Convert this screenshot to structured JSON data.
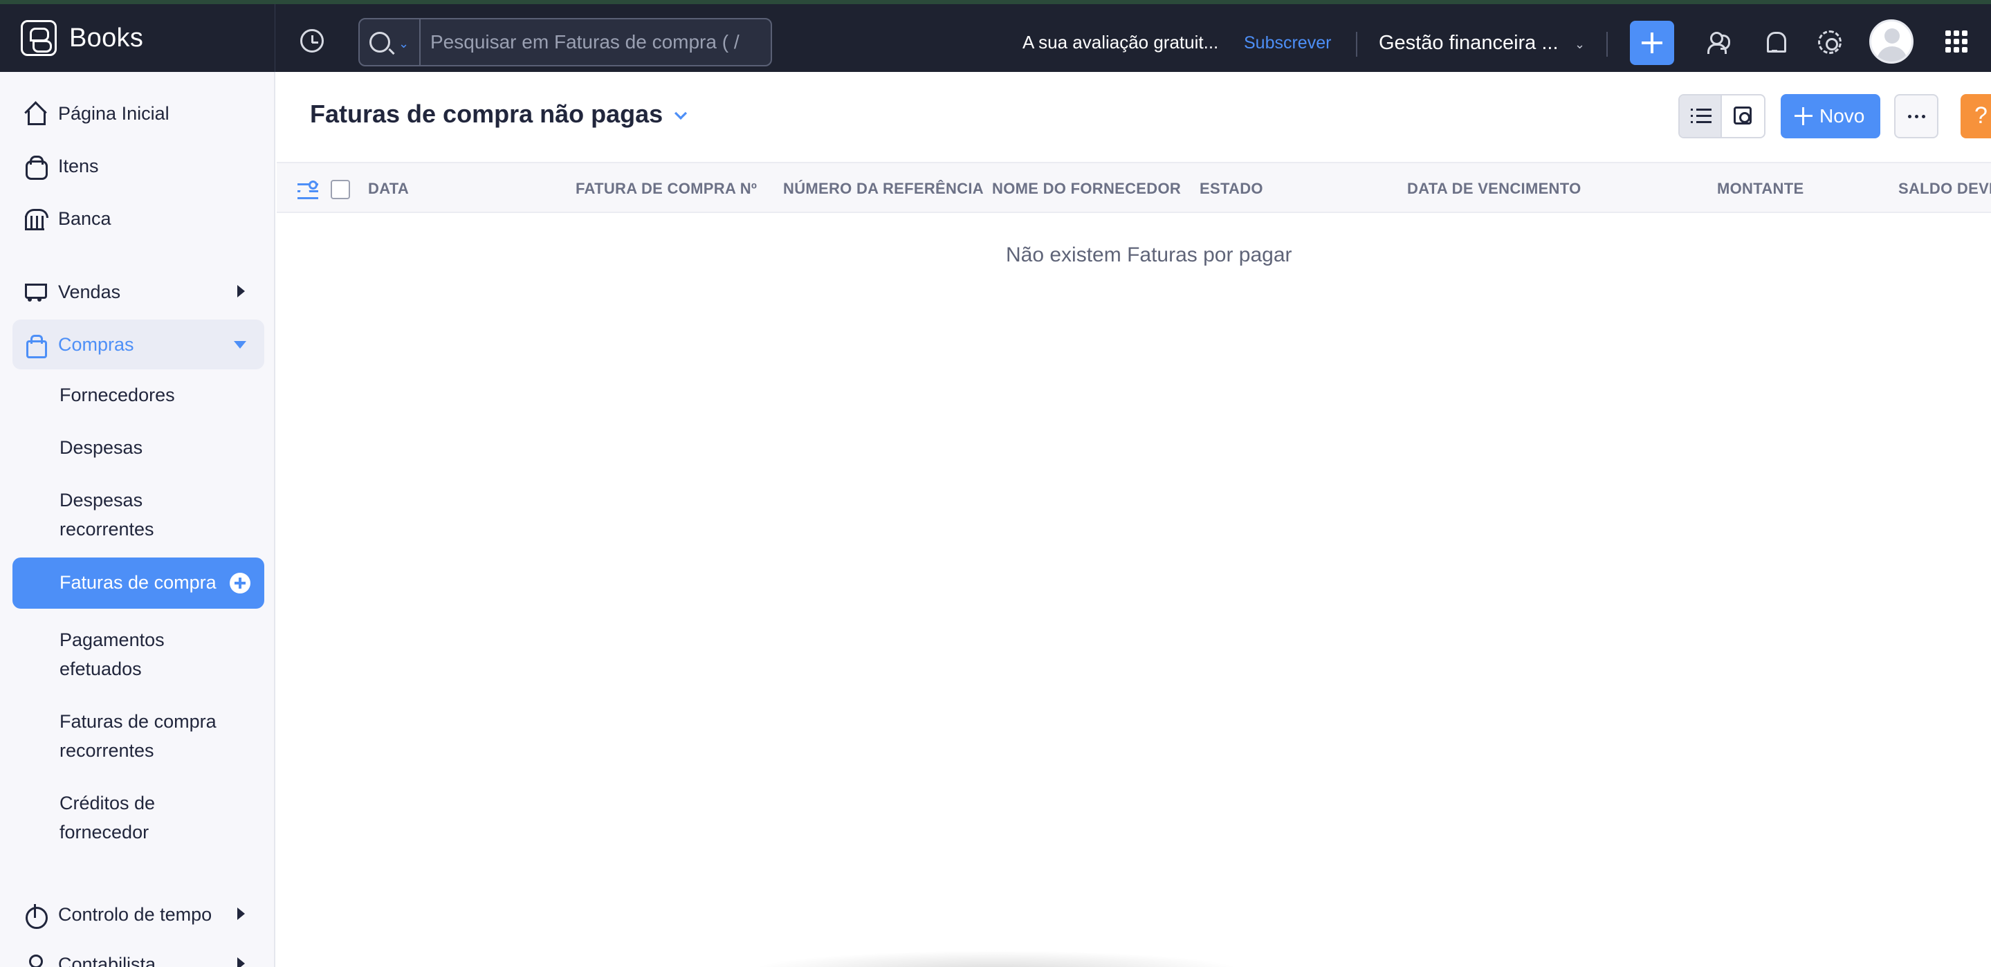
{
  "app": {
    "name": "Books"
  },
  "topbar": {
    "search_placeholder": "Pesquisar em Faturas de compra ( / ",
    "trial_text": "A sua avaliação gratuit...",
    "subscribe_label": "Subscrever",
    "org_name": "Gestão financeira ..."
  },
  "sidebar": {
    "items": [
      {
        "label": "Página Inicial",
        "icon": "home-icon"
      },
      {
        "label": "Itens",
        "icon": "items-icon"
      },
      {
        "label": "Banca",
        "icon": "bank-icon"
      },
      {
        "label": "Vendas",
        "icon": "cart-icon"
      },
      {
        "label": "Compras",
        "icon": "bag-icon",
        "expanded": true
      },
      {
        "label": "Controlo de tempo",
        "icon": "timer-icon"
      },
      {
        "label": "Contabilista",
        "icon": "accountant-icon"
      }
    ],
    "compras_sub": [
      {
        "label": "Fornecedores"
      },
      {
        "label": "Despesas"
      },
      {
        "label": "Despesas recorrentes"
      },
      {
        "label": "Faturas de compra",
        "active": true
      },
      {
        "label": "Pagamentos efetuados"
      },
      {
        "label": "Faturas de compra recorrentes"
      },
      {
        "label": "Créditos de fornecedor"
      }
    ]
  },
  "main": {
    "title": "Faturas de compra não pagas",
    "new_button_label": "Novo",
    "help_label": "?",
    "columns": [
      "DATA",
      "FATURA DE COMPRA Nº",
      "NÚMERO DA REFERÊNCIA",
      "NOME DO FORNECEDOR",
      "ESTADO",
      "DATA DE VENCIMENTO",
      "MONTANTE",
      "SALDO DEVI"
    ],
    "empty_message": "Não existem Faturas por pagar"
  },
  "colors": {
    "accent": "#4d8ff7",
    "topbar_bg": "#1e2230",
    "help_orange": "#f7923b"
  }
}
